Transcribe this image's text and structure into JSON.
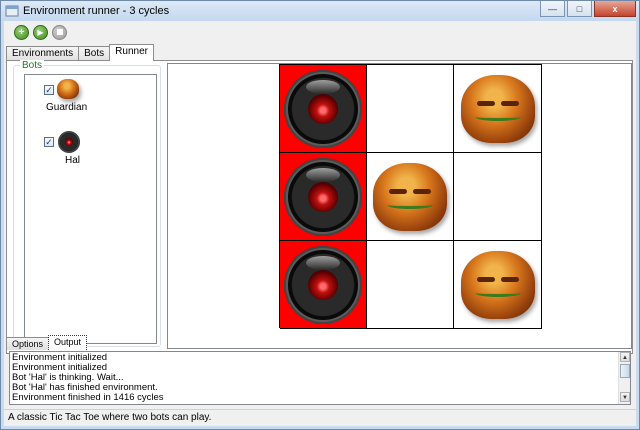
{
  "window": {
    "title": "Environment runner - 3  cycles",
    "buttons": {
      "minimize": "—",
      "maximize": "□",
      "close": "x"
    }
  },
  "toolbar": {
    "add_icon": "plus-circle-icon",
    "play_icon": "play-circle-icon",
    "stop_icon": "stop-circle-icon"
  },
  "tabs": [
    {
      "label": "Environments"
    },
    {
      "label": "Bots"
    },
    {
      "label": "Runner"
    }
  ],
  "bots": {
    "group_label": "Bots",
    "items": [
      {
        "label": "Guardian",
        "checked": true,
        "icon": "guardian-icon"
      },
      {
        "label": "Hal",
        "checked": true,
        "icon": "hal-eye-icon"
      }
    ]
  },
  "board": {
    "cells": [
      {
        "piece": "hal",
        "winning": true
      },
      {
        "piece": "",
        "winning": false
      },
      {
        "piece": "guardian",
        "winning": false
      },
      {
        "piece": "hal",
        "winning": true
      },
      {
        "piece": "guardian",
        "winning": false
      },
      {
        "piece": "",
        "winning": false
      },
      {
        "piece": "hal",
        "winning": true
      },
      {
        "piece": "",
        "winning": false
      },
      {
        "piece": "guardian",
        "winning": false
      }
    ],
    "win_color": "#ff0000"
  },
  "bottom_tabs": [
    {
      "label": "Options"
    },
    {
      "label": "Output"
    }
  ],
  "output": {
    "lines": [
      "Environment initialized",
      "Environment initialized",
      "Bot 'Hal' is thinking. Wait...",
      "Bot 'Hal' has finished environment.",
      "Environment finished in 1416 cycles"
    ]
  },
  "status": {
    "text": "A classic Tic Tac Toe where two bots can play."
  }
}
